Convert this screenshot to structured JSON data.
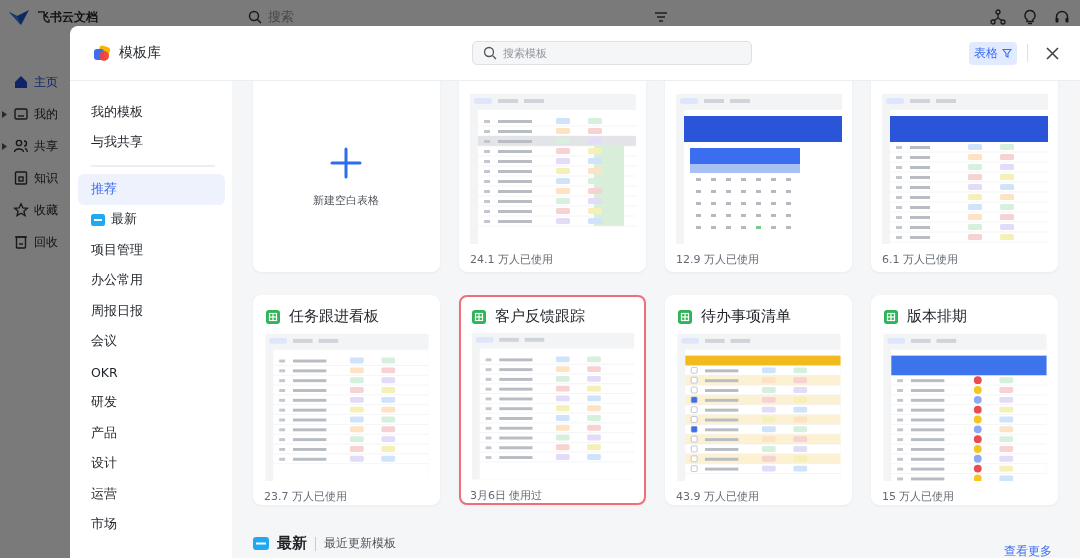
{
  "app": {
    "name": "飞书云文档",
    "search_placeholder": "搜索",
    "nav": [
      {
        "label": "主页",
        "selected": true
      },
      {
        "label": "我的",
        "selected": false,
        "expanded": false
      },
      {
        "label": "共享",
        "selected": false,
        "expanded": false
      },
      {
        "label": "知识",
        "selected": false
      },
      {
        "label": "收藏",
        "selected": false
      },
      {
        "label": "回收",
        "selected": false
      }
    ]
  },
  "modal": {
    "title": "模板库",
    "search_placeholder": "搜索模板",
    "filter": "表格",
    "nav_top": [
      {
        "label": "我的模板",
        "selected": false
      },
      {
        "label": "与我共享",
        "selected": false
      }
    ],
    "nav": [
      {
        "label": "推荐",
        "kind": "plain",
        "selected": true
      },
      {
        "label": "最新",
        "kind": "new",
        "selected": false
      },
      {
        "label": "项目管理",
        "kind": "plain",
        "selected": false
      },
      {
        "label": "办公常用",
        "kind": "plain",
        "selected": false
      },
      {
        "label": "周报日报",
        "kind": "plain",
        "selected": false
      },
      {
        "label": "会议",
        "kind": "plain",
        "selected": false
      },
      {
        "label": "OKR",
        "kind": "plain",
        "selected": false
      },
      {
        "label": "研发",
        "kind": "plain",
        "selected": false
      },
      {
        "label": "产品",
        "kind": "plain",
        "selected": false
      },
      {
        "label": "设计",
        "kind": "plain",
        "selected": false
      },
      {
        "label": "运营",
        "kind": "plain",
        "selected": false
      },
      {
        "label": "市场",
        "kind": "plain",
        "selected": false
      }
    ],
    "cards": [
      {
        "kind": "blank",
        "label": "新建空白表格",
        "selected": false
      },
      {
        "kind": "template",
        "usage": "24.1 万人已使用",
        "selected": false
      },
      {
        "kind": "template",
        "usage": "12.9 万人已使用",
        "selected": false
      },
      {
        "kind": "template",
        "usage": "6.1 万人已使用",
        "selected": false
      },
      {
        "kind": "template",
        "title": "任务跟进看板",
        "usage": "23.7 万人已使用",
        "selected": false
      },
      {
        "kind": "template",
        "title": "客户反馈跟踪",
        "usage": "3月6日 使用过",
        "selected": true
      },
      {
        "kind": "template",
        "title": "待办事项清单",
        "usage": "43.9 万人已使用",
        "selected": false
      },
      {
        "kind": "template",
        "title": "版本排期",
        "usage": "15 万人已使用",
        "selected": false
      }
    ],
    "section": {
      "title": "最新",
      "subtitle": "最近更新模板",
      "more_link": "查看更多"
    }
  }
}
